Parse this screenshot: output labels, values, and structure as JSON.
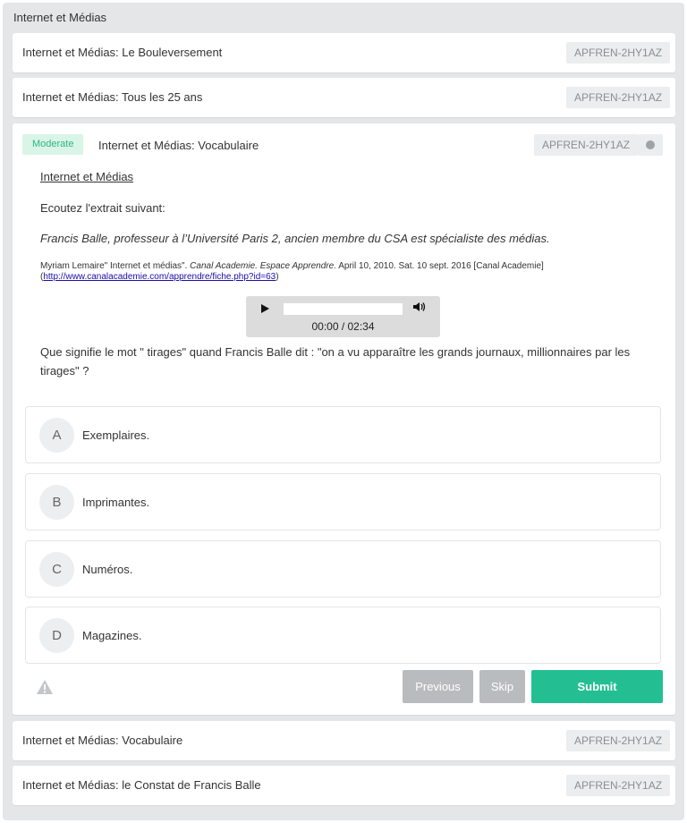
{
  "section": {
    "title": "Internet et Médias"
  },
  "rows_top": [
    {
      "title": "Internet et Médias: Le Bouleversement",
      "code": "APFREN-2HY1AZ"
    },
    {
      "title": "Internet et Médias: Tous les 25 ans",
      "code": "APFREN-2HY1AZ"
    }
  ],
  "active": {
    "difficulty": "Moderate",
    "title": "Internet et Médias: Vocabulaire",
    "code": "APFREN-2HY1AZ",
    "heading": "Internet et Médias",
    "instruction": "Ecoutez l'extrait suivant:",
    "quote": "Francis Balle, professeur à l’Université Paris 2, ancien membre du CSA est spécialiste des médias.",
    "citation": {
      "prefix": "Myriam Lemaire\" Internet et médias\". ",
      "italic": "Canal Academie. Espace Apprendre.",
      "suffix": " April 10, 2010. Sat. 10 sept. 2016 [Canal Academie]",
      "link_open": "(",
      "link": "http://www.canalacademie.com/apprendre/fiche.php?id=63",
      "link_close": ")"
    },
    "audio": {
      "time": "00:00 / 02:34",
      "progress": 0
    },
    "question": "Que signifie le mot \" tirages\" quand Francis Balle dit : \"on a vu apparaître les grands journaux, millionnaires par les tirages\" ?",
    "options": [
      {
        "letter": "A",
        "text": "Exemplaires."
      },
      {
        "letter": "B",
        "text": "Imprimantes."
      },
      {
        "letter": "C",
        "text": "Numéros."
      },
      {
        "letter": "D",
        "text": "Magazines."
      }
    ],
    "buttons": {
      "previous": "Previous",
      "skip": "Skip",
      "submit": "Submit"
    }
  },
  "rows_bottom": [
    {
      "title": "Internet et Médias: Vocabulaire",
      "code": "APFREN-2HY1AZ"
    },
    {
      "title": "Internet et Médias: le Constat de Francis Balle",
      "code": "APFREN-2HY1AZ"
    }
  ],
  "colors": {
    "accent": "#23bf93",
    "moderate": "#2eb67f",
    "badge_bg": "#ebedee"
  }
}
